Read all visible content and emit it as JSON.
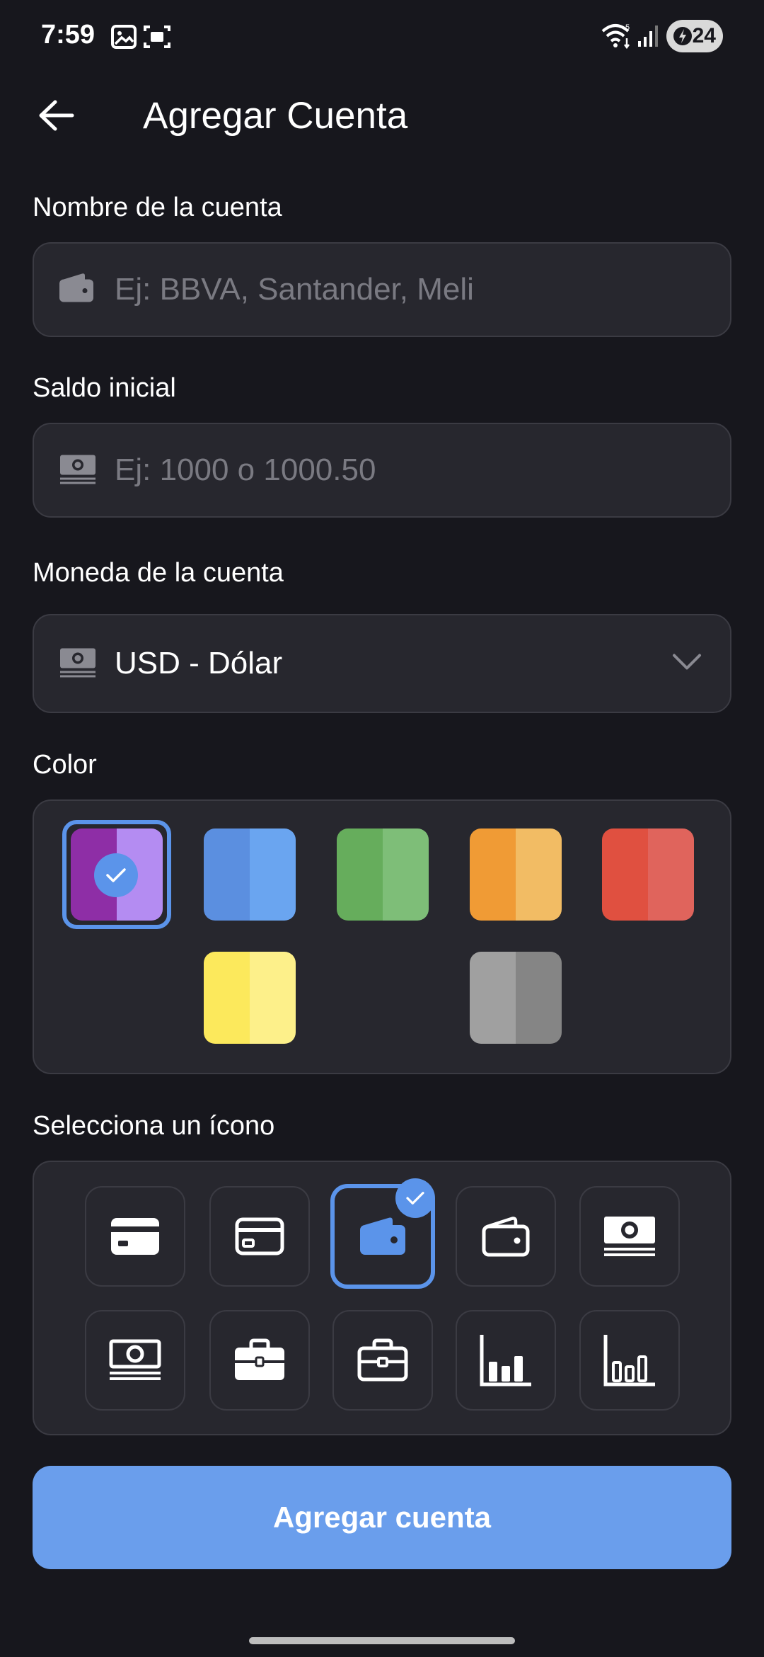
{
  "status_bar": {
    "time": "7:59",
    "battery": "24"
  },
  "header": {
    "title": "Agregar Cuenta"
  },
  "account_name": {
    "label": "Nombre de la cuenta",
    "placeholder": "Ej: BBVA, Santander, Meli",
    "value": ""
  },
  "initial_balance": {
    "label": "Saldo inicial",
    "placeholder": "Ej: 1000 o 1000.50",
    "value": ""
  },
  "currency": {
    "label": "Moneda de la cuenta",
    "selected": "USD - Dólar"
  },
  "color": {
    "label": "Color",
    "selected_index": 0,
    "options": [
      {
        "name": "purple",
        "dark": "#8e2ea6",
        "light": "#b48cf2"
      },
      {
        "name": "blue",
        "dark": "#5b8fe0",
        "light": "#6aa5f0"
      },
      {
        "name": "green",
        "dark": "#66ad5c",
        "light": "#7ebe78"
      },
      {
        "name": "orange",
        "dark": "#f09b35",
        "light": "#f2bc64"
      },
      {
        "name": "red",
        "dark": "#e05040",
        "light": "#e0645c"
      },
      {
        "name": "yellow",
        "dark": "#fce95c",
        "light": "#fdf08a"
      },
      {
        "name": "gray",
        "dark": "#a0a0a0",
        "light": "#858585"
      }
    ]
  },
  "icons": {
    "label": "Selecciona un ícono",
    "selected_index": 2,
    "items": [
      "credit-card-filled-icon",
      "credit-card-outline-icon",
      "wallet-filled-icon",
      "wallet-outline-icon",
      "money-bills-filled-icon",
      "money-bills-outline-icon",
      "briefcase-filled-icon",
      "briefcase-outline-icon",
      "bar-chart-filled-icon",
      "bar-chart-outline-icon"
    ]
  },
  "submit": {
    "label": "Agregar cuenta"
  },
  "colors": {
    "accent": "#5b94ea",
    "button": "#6a9eec",
    "background": "#17171d",
    "surface": "#27272e",
    "border": "#3b3b43"
  }
}
